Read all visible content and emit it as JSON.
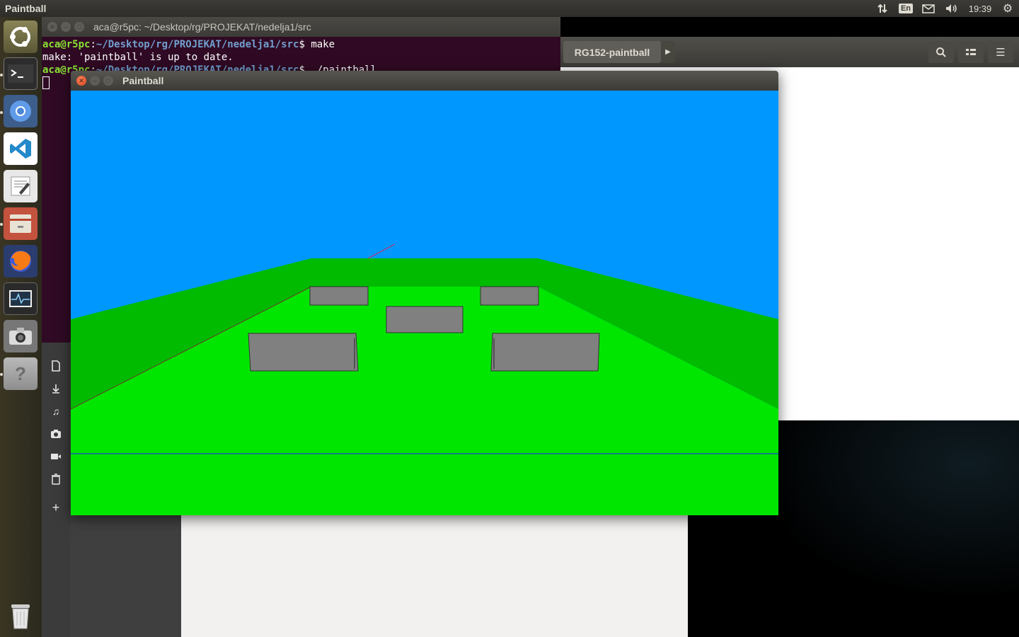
{
  "top_panel": {
    "app_title": "Paintball",
    "keyboard_layout": "En",
    "clock": "19:39"
  },
  "launcher": {
    "items": [
      {
        "name": "Ubuntu Dash",
        "icon": "ubuntu-logo-icon"
      },
      {
        "name": "Terminal",
        "icon": "terminal-icon"
      },
      {
        "name": "Chromium",
        "icon": "chromium-icon"
      },
      {
        "name": "Visual Studio Code",
        "icon": "vscode-icon"
      },
      {
        "name": "Text Editor",
        "icon": "text-editor-icon"
      },
      {
        "name": "Files",
        "icon": "file-cabinet-icon"
      },
      {
        "name": "Firefox",
        "icon": "firefox-icon"
      },
      {
        "name": "System Monitor",
        "icon": "system-monitor-icon"
      },
      {
        "name": "Screenshot",
        "icon": "camera-icon"
      },
      {
        "name": "Help",
        "icon": "help-icon"
      },
      {
        "name": "Trash",
        "icon": "trash-icon"
      }
    ]
  },
  "terminal": {
    "title": "aca@r5pc: ~/Desktop/rg/PROJEKAT/nedelja1/src",
    "prompt_user": "aca@r5pc",
    "prompt_path": "~/Desktop/rg/PROJEKAT/nedelja1/src",
    "command1": "make",
    "output1": "make: 'paintball' is up to date.",
    "command2": "./paintball"
  },
  "right_app": {
    "path_label": "RG152-paintball"
  },
  "files_sidebar": {
    "icons": [
      "document-icon",
      "download-icon",
      "music-icon",
      "camera-icon",
      "video-icon",
      "trash-icon",
      "add-icon"
    ]
  },
  "paintball_window": {
    "title": "Paintball",
    "colors": {
      "sky": "#0098ff",
      "field": "#00e600",
      "walls": "#00bb00",
      "obstacle": "#808080",
      "horizon_line": "#1a1aff",
      "aim_line": "#c0306a"
    }
  }
}
